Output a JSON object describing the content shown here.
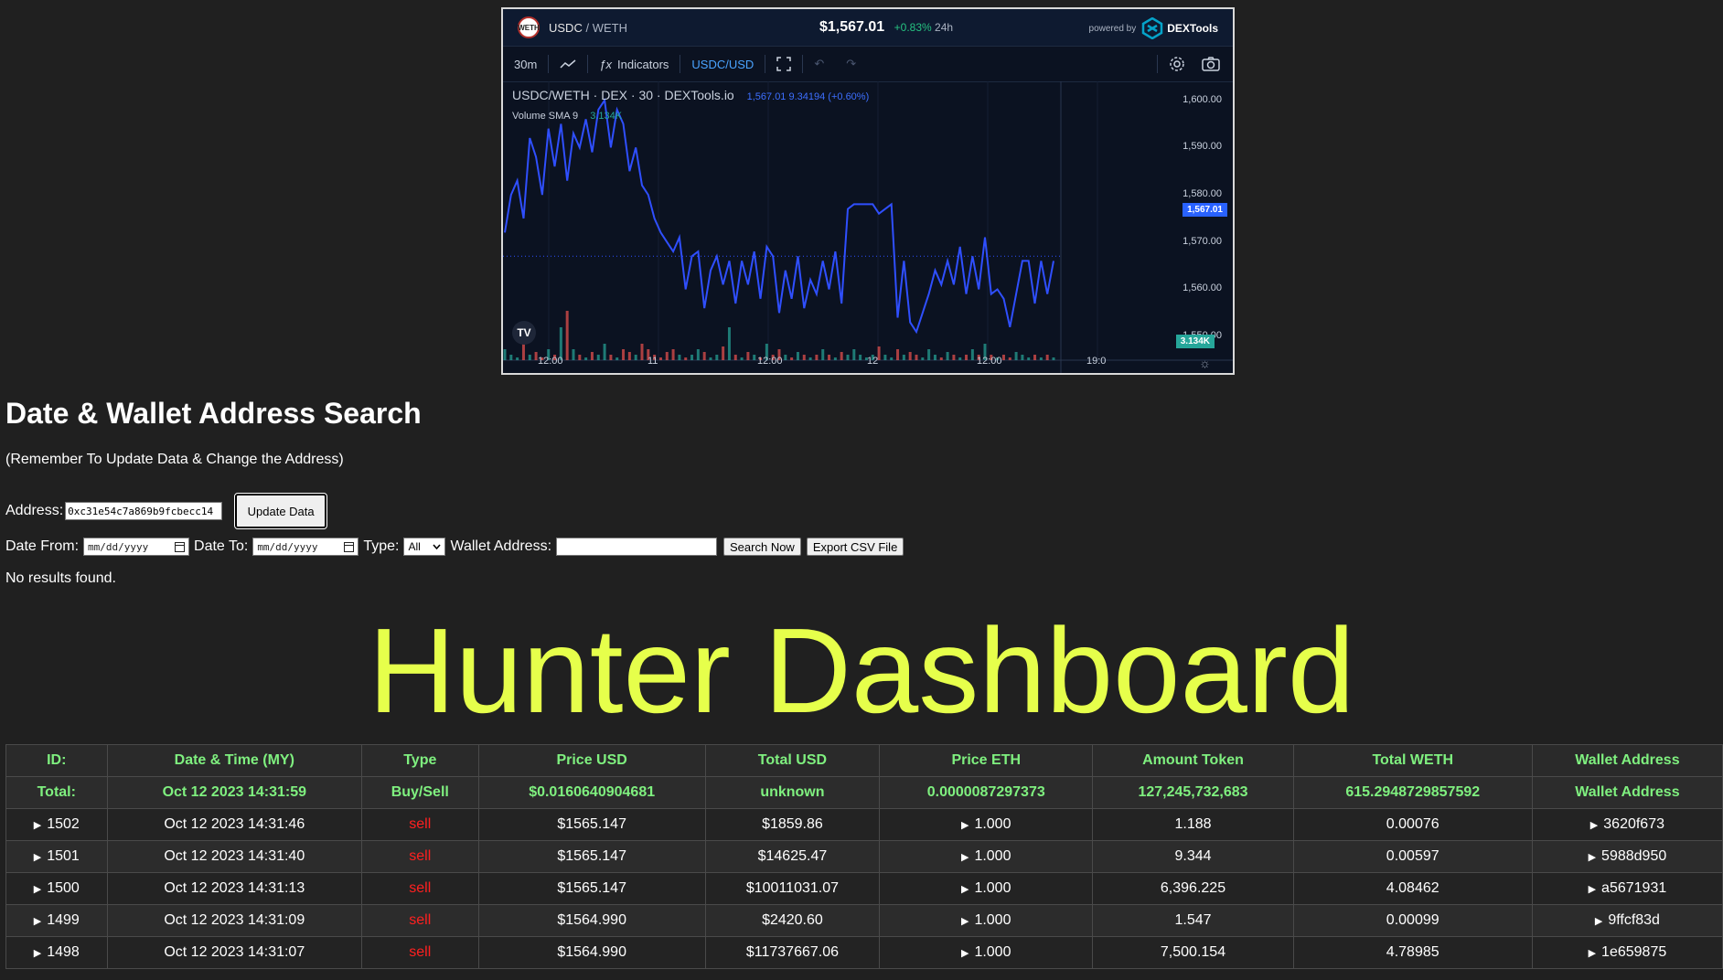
{
  "widget": {
    "pair_logo": "WETH",
    "pair_base": "USDC",
    "pair_quote": "WETH",
    "price": "$1,567.01",
    "change": "+0.83%",
    "change_period": "24h",
    "powered_by": "powered by",
    "brand": "DEXTools",
    "toolbar": {
      "interval": "30m",
      "indicators": "Indicators",
      "currency": "USDC/USD"
    },
    "legend_title": "USDC/WETH · DEX · 30 · DEXTools.io",
    "legend_values": "1,567.01  9.34194 (+0.60%)",
    "volume_label": "Volume SMA 9",
    "volume_value": "3.134K",
    "last_price_tag": "1,567.01",
    "volume_tag": "3.134K",
    "tv_logo": "TV",
    "colors": {
      "line": "#2f4fff",
      "up": "#26a69a",
      "down": "#ef5350",
      "background": "#0b1221"
    }
  },
  "chart_data": {
    "type": "line",
    "y_ticks": [
      "1,600.00",
      "1,590.00",
      "1,580.00",
      "1,570.00",
      "1,560.00",
      "1,550.00"
    ],
    "x_ticks": [
      "12:00",
      "11",
      "12:00",
      "12",
      "12:00",
      "19:0"
    ],
    "ylim": [
      1545,
      1604
    ],
    "series": [
      {
        "values": [
          1572,
          1580,
          1583,
          1575,
          1592,
          1588,
          1580,
          1594,
          1586,
          1595,
          1583,
          1593,
          1590,
          1596,
          1589,
          1598,
          1600,
          1590,
          1598,
          1595,
          1585,
          1590,
          1582,
          1580,
          1575,
          1572,
          1570,
          1568,
          1571,
          1560,
          1567,
          1568,
          1556,
          1564,
          1567,
          1561,
          1566,
          1557,
          1566,
          1561,
          1568,
          1558,
          1569,
          1567,
          1555,
          1564,
          1558,
          1567,
          1556,
          1562,
          1559,
          1566,
          1560,
          1568,
          1557,
          1577,
          1578,
          1578,
          1578,
          1578,
          1576,
          1577,
          1578,
          1554,
          1566,
          1553,
          1551,
          1555,
          1559,
          1564,
          1561,
          1566,
          1561,
          1569,
          1559,
          1567,
          1560,
          1571,
          1559,
          1560,
          1558,
          1552,
          1559,
          1566,
          1566,
          1557,
          1566,
          1559,
          1566
        ]
      }
    ],
    "volume": [
      0.2,
      0.1,
      0.05,
      0.3,
      0.1,
      0.15,
      0.05,
      0.2,
      0.1,
      0.6,
      0.9,
      0.2,
      0.1,
      0.05,
      0.15,
      0.1,
      0.3,
      0.1,
      0.05,
      0.2,
      0.15,
      0.1,
      0.3,
      0.2,
      0.1,
      0.05,
      0.15,
      0.2,
      0.1,
      0.05,
      0.1,
      0.2,
      0.15,
      0.05,
      0.1,
      0.25,
      0.6,
      0.1,
      0.05,
      0.15,
      0.1,
      0.05,
      0.3,
      0.1,
      0.2,
      0.1,
      0.05,
      0.15,
      0.1,
      0.05,
      0.1,
      0.2,
      0.1,
      0.05,
      0.15,
      0.1,
      0.2,
      0.1,
      0.05,
      0.1,
      0.25,
      0.1,
      0.05,
      0.2,
      0.1,
      0.15,
      0.1,
      0.05,
      0.2,
      0.1,
      0.05,
      0.15,
      0.1,
      0.05,
      0.1,
      0.2,
      0.1,
      0.3,
      0.1,
      0.05,
      0.1,
      0.05,
      0.15,
      0.1,
      0.05,
      0.1,
      0.05,
      0.1,
      0.05
    ]
  },
  "search": {
    "title": "Date & Wallet Address Search",
    "reminder": "(Remember To Update Data & Change the Address)",
    "address_label": "Address:",
    "address_value": "0xc31e54c7a869b9fcbecc14",
    "update_button": "Update Data",
    "date_from_label": "Date From:",
    "date_placeholder": "mm/dd/yyyy",
    "date_to_label": "Date To:",
    "type_label": "Type:",
    "type_value": "All",
    "wallet_label": "Wallet Address:",
    "search_button": "Search Now",
    "export_button": "Export CSV File",
    "no_results": "No results found."
  },
  "dashboard": {
    "title": "Hunter Dashboard",
    "columns": [
      "ID:",
      "Date & Time (MY)",
      "Type",
      "Price USD",
      "Total USD",
      "Price ETH",
      "Amount Token",
      "Total WETH",
      "Wallet Address"
    ],
    "total_row": [
      "Total:",
      "Oct 12 2023 14:31:59",
      "Buy/Sell",
      "$0.0160640904681",
      "unknown",
      "0.0000087297373",
      "127,245,732,683",
      "615.2948729857592",
      "Wallet Address"
    ],
    "rows": [
      {
        "id": "1502",
        "datetime": "Oct 12 2023 14:31:46",
        "type": "sell",
        "price_usd": "$1565.147",
        "total_usd": "$1859.86",
        "price_eth": "1.000",
        "amount": "1.188",
        "total_weth": "0.00076",
        "wallet": "3620f673"
      },
      {
        "id": "1501",
        "datetime": "Oct 12 2023 14:31:40",
        "type": "sell",
        "price_usd": "$1565.147",
        "total_usd": "$14625.47",
        "price_eth": "1.000",
        "amount": "9.344",
        "total_weth": "0.00597",
        "wallet": "5988d950"
      },
      {
        "id": "1500",
        "datetime": "Oct 12 2023 14:31:13",
        "type": "sell",
        "price_usd": "$1565.147",
        "total_usd": "$10011031.07",
        "price_eth": "1.000",
        "amount": "6,396.225",
        "total_weth": "4.08462",
        "wallet": "a5671931"
      },
      {
        "id": "1499",
        "datetime": "Oct 12 2023 14:31:09",
        "type": "sell",
        "price_usd": "$1564.990",
        "total_usd": "$2420.60",
        "price_eth": "1.000",
        "amount": "1.547",
        "total_weth": "0.00099",
        "wallet": "9ffcf83d"
      },
      {
        "id": "1498",
        "datetime": "Oct 12 2023 14:31:07",
        "type": "sell",
        "price_usd": "$1564.990",
        "total_usd": "$11737667.06",
        "price_eth": "1.000",
        "amount": "7,500.154",
        "total_weth": "4.78985",
        "wallet": "1e659875"
      }
    ]
  }
}
